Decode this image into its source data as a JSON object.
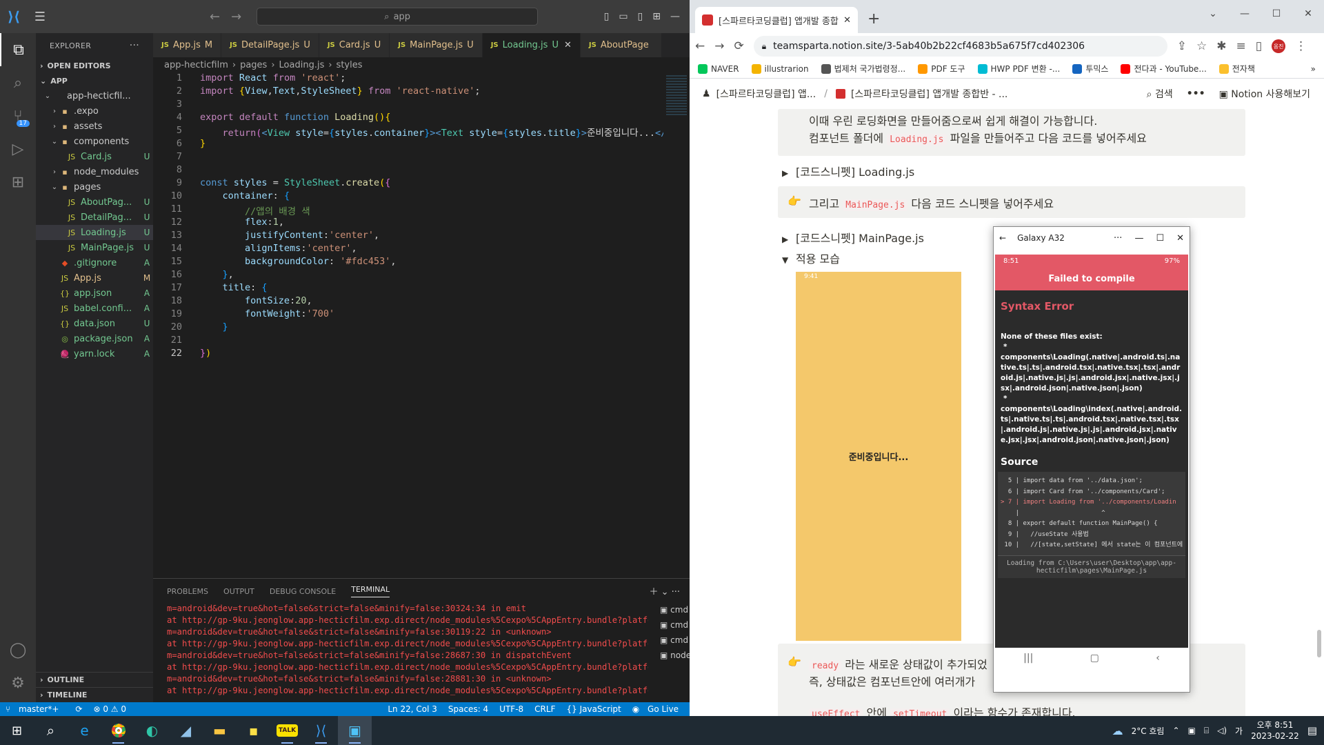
{
  "vscode": {
    "search_text": "app",
    "explorer_title": "EXPLORER",
    "open_editors": "OPEN EDITORS",
    "app_section": "APP",
    "tree": [
      {
        "name": "app-hecticfil...",
        "status": "",
        "kind": "folder",
        "indent": 1,
        "open": true
      },
      {
        "name": ".expo",
        "status": "",
        "kind": "folder",
        "indent": 2,
        "open": false
      },
      {
        "name": "assets",
        "status": "",
        "kind": "folder",
        "indent": 2,
        "open": false
      },
      {
        "name": "components",
        "status": "",
        "kind": "folder",
        "indent": 2,
        "open": true
      },
      {
        "name": "Card.js",
        "status": "U",
        "kind": "js",
        "indent": 3
      },
      {
        "name": "node_modules",
        "status": "",
        "kind": "folder",
        "indent": 2,
        "open": false
      },
      {
        "name": "pages",
        "status": "",
        "kind": "folder",
        "indent": 2,
        "open": true
      },
      {
        "name": "AboutPag...",
        "status": "U",
        "kind": "js",
        "indent": 3
      },
      {
        "name": "DetailPag...",
        "status": "U",
        "kind": "js",
        "indent": 3
      },
      {
        "name": "Loading.js",
        "status": "U",
        "kind": "js",
        "indent": 3,
        "selected": true
      },
      {
        "name": "MainPage.js",
        "status": "U",
        "kind": "js",
        "indent": 3
      },
      {
        "name": ".gitignore",
        "status": "A",
        "kind": "git",
        "indent": 2
      },
      {
        "name": "App.js",
        "status": "M",
        "kind": "js",
        "indent": 2
      },
      {
        "name": "app.json",
        "status": "A",
        "kind": "json",
        "indent": 2
      },
      {
        "name": "babel.confi...",
        "status": "A",
        "kind": "js",
        "indent": 2
      },
      {
        "name": "data.json",
        "status": "U",
        "kind": "json",
        "indent": 2
      },
      {
        "name": "package.json",
        "status": "A",
        "kind": "pkg",
        "indent": 2
      },
      {
        "name": "yarn.lock",
        "status": "A",
        "kind": "yarn",
        "indent": 2
      }
    ],
    "outline": "OUTLINE",
    "timeline": "TIMELINE",
    "tabs": [
      {
        "name": "App.js",
        "status": "M"
      },
      {
        "name": "DetailPage.js",
        "status": "U"
      },
      {
        "name": "Card.js",
        "status": "U"
      },
      {
        "name": "MainPage.js",
        "status": "U"
      },
      {
        "name": "Loading.js",
        "status": "U",
        "active": true
      },
      {
        "name": "AboutPage",
        "status": ""
      }
    ],
    "breadcrumb": [
      "app-hecticfilm",
      "pages",
      "Loading.js",
      "styles"
    ],
    "panel_tabs": [
      "PROBLEMS",
      "OUTPUT",
      "DEBUG CONSOLE",
      "TERMINAL"
    ],
    "terminal_lines": [
      "m=android&dev=true&hot=false&strict=false&minify=false:30324:34 in emit",
      "at http://gp-9ku.jeonglow.app-hecticfilm.exp.direct/node_modules%5Cexpo%5CAppEntry.bundle?platfor",
      "m=android&dev=true&hot=false&strict=false&minify=false:30119:22 in <unknown>",
      "at http://gp-9ku.jeonglow.app-hecticfilm.exp.direct/node_modules%5Cexpo%5CAppEntry.bundle?platfor",
      "m=android&dev=true&hot=false&strict=false&minify=false:28687:30 in dispatchEvent",
      "at http://gp-9ku.jeonglow.app-hecticfilm.exp.direct/node_modules%5Cexpo%5CAppEntry.bundle?platfor",
      "m=android&dev=true&hot=false&strict=false&minify=false:28881:30 in <unknown>",
      "at http://gp-9ku.jeonglow.app-hecticfilm.exp.direct/node_modules%5Cexpo%5CAppEntry.bundle?platfor"
    ],
    "terminal_list": [
      "cmd",
      "cmd",
      "cmd",
      "node"
    ],
    "status": {
      "branch": "master*+",
      "errors": "⊗ 0 ⚠ 0",
      "position": "Ln 22, Col 3",
      "spaces": "Spaces: 4",
      "encoding": "UTF-8",
      "eol": "CRLF",
      "language": "{} JavaScript",
      "golive": "Go Live"
    },
    "badge": "17"
  },
  "chrome": {
    "tab_title": "[스파르타코딩클럽] 앱개발 종합",
    "url": "teamsparta.notion.site/3-5ab40b2b22cf4683b5a675f7cd402306",
    "bookmarks": [
      "NAVER",
      "illustrarion",
      "법제처 국가법령정...",
      "PDF 도구",
      "HWP PDF 변환 -...",
      "투믹스",
      "전다과 - YouTube...",
      "전자책"
    ],
    "profile": "옹진",
    "notion_crumb1": "[스파르타코딩클럽] 앱...",
    "notion_crumb2": "[스파르타코딩클럽] 앱개발 종합반 - ...",
    "notion_search": "검색",
    "notion_try": "Notion 사용해보기",
    "line1": "이때 우린 로딩화면을 만들어줌으로써 쉽게 해결이 가능합니다.",
    "line2_pre": "컴포넌트 폴더에 ",
    "line2_code": "Loading.js",
    "line2_post": " 파일을 만들어주고 다음 코드를 넣어주세요",
    "toggle1": "[코드스니펫] Loading.js",
    "callout2_pre": "그리고 ",
    "callout2_code": "MainPage.js",
    "callout2_post": " 다음 코드 스니펫을 넣어주세요",
    "toggle2": "[코드스니펫] MainPage.js",
    "toggle3": "적용 모습",
    "phone_time": "9:41",
    "phone_text": "준비중입니다...",
    "bottom1_code": "ready",
    "bottom1": " 라는 새로운 상태값이 추가되었",
    "bottom2": "즉, 상태값은 컴포넌트안에 여러개가 ",
    "bottom3_code1": "useEffect",
    "bottom3_mid": " 안에 ",
    "bottom3_code2": "setTimeout",
    "bottom3_post": " 이라는 함수가 존재합니다."
  },
  "emulator": {
    "title": "Galaxy A32",
    "status_time": "8:51",
    "battery": "97%",
    "fail": "Failed to compile",
    "error_title": "Syntax Error",
    "msg1": "None of these files exist:",
    "msg2": "*",
    "msg3": "components\\Loading(.native|.android.ts|.native.ts|.ts|.android.tsx|.native.tsx|.tsx|.android.js|.native.js|.js|.android.jsx|.native.jsx|.jsx|.android.json|.native.json|.json)",
    "msg4": "*",
    "msg5": "components\\Loading\\index(.native|.android.ts|.native.ts|.ts|.android.tsx|.native.tsx|.tsx|.android.js|.native.js|.js|.android.jsx|.native.jsx|.jsx|.android.json|.native.json|.json)",
    "source_title": "Source",
    "source_lines": [
      "  5 | import data from '../data.json';",
      "  6 | import Card from '../components/Card';",
      "> 7 | import Loading from '../components/Loadin",
      "    |                      ^",
      "  8 | export default function MainPage() {",
      "  9 |   //useState 사용법",
      " 10 |   //[state,setState] 에서 state는 이 컴포넌트에"
    ],
    "loading_from": "Loading from C:\\Users\\user\\Desktop\\app\\app-hecticfilm\\pages\\MainPage.js"
  },
  "taskbar": {
    "weather": "2°C 흐림",
    "time": "오후 8:51",
    "date": "2023-02-22"
  }
}
